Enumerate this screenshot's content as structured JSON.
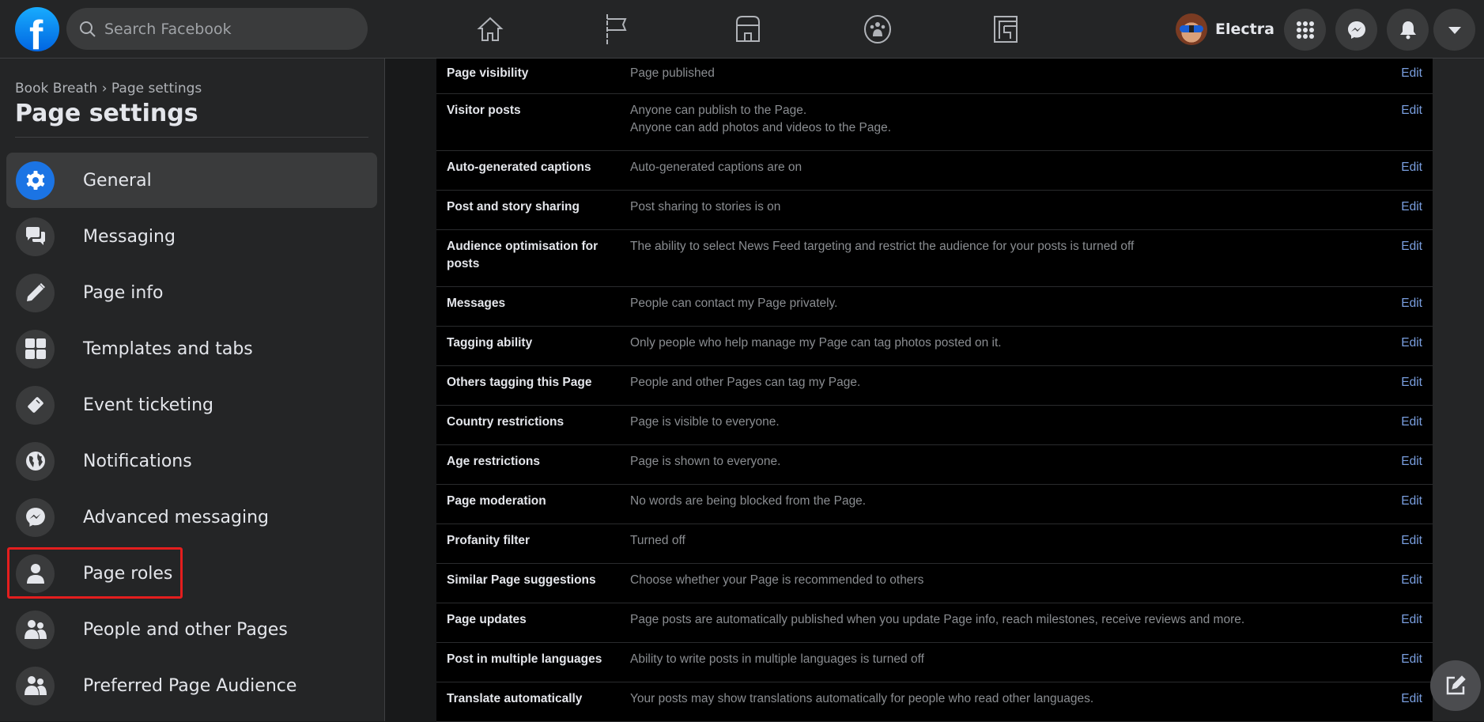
{
  "header": {
    "search_placeholder": "Search Facebook",
    "user_name": "Electra"
  },
  "sidebar": {
    "breadcrumb": "Book Breath › Page settings",
    "title": "Page settings",
    "items": [
      {
        "label": "General",
        "icon": "gear-icon",
        "active": true
      },
      {
        "label": "Messaging",
        "icon": "chat-bubbles-icon"
      },
      {
        "label": "Page info",
        "icon": "pencil-icon"
      },
      {
        "label": "Templates and tabs",
        "icon": "grid-icon"
      },
      {
        "label": "Event ticketing",
        "icon": "ticket-icon"
      },
      {
        "label": "Notifications",
        "icon": "globe-icon"
      },
      {
        "label": "Advanced messaging",
        "icon": "messenger-icon"
      },
      {
        "label": "Page roles",
        "icon": "person-icon",
        "highlighted": true
      },
      {
        "label": "People and other Pages",
        "icon": "people-icon"
      },
      {
        "label": "Preferred Page Audience",
        "icon": "people-icon"
      }
    ]
  },
  "settings": {
    "edit_label": "Edit",
    "rows": [
      {
        "label": "Page visibility",
        "value": "Page published"
      },
      {
        "label": "Visitor posts",
        "value": "Anyone can publish to the Page.",
        "value2": "Anyone can add photos and videos to the Page."
      },
      {
        "label": "Auto-generated captions",
        "value": "Auto-generated captions are on"
      },
      {
        "label": "Post and story sharing",
        "value": "Post sharing to stories is on"
      },
      {
        "label": "Audience optimisation for posts",
        "value": "The ability to select News Feed targeting and restrict the audience for your posts is turned off"
      },
      {
        "label": "Messages",
        "value": "People can contact my Page privately."
      },
      {
        "label": "Tagging ability",
        "value": "Only people who help manage my Page can tag photos posted on it."
      },
      {
        "label": "Others tagging this Page",
        "value": "People and other Pages can tag my Page."
      },
      {
        "label": "Country restrictions",
        "value": "Page is visible to everyone."
      },
      {
        "label": "Age restrictions",
        "value": "Page is shown to everyone."
      },
      {
        "label": "Page moderation",
        "value": "No words are being blocked from the Page."
      },
      {
        "label": "Profanity filter",
        "value": "Turned off"
      },
      {
        "label": "Similar Page suggestions",
        "value": "Choose whether your Page is recommended to others"
      },
      {
        "label": "Page updates",
        "value": "Page posts are automatically published when you update Page info, reach milestones, receive reviews and more."
      },
      {
        "label": "Post in multiple languages",
        "value": "Ability to write posts in multiple languages is turned off"
      },
      {
        "label": "Translate automatically",
        "value": "Your posts may show translations automatically for people who read other languages."
      }
    ]
  },
  "colors": {
    "accent": "#1b74e4",
    "edit_link": "#7a9fe0",
    "highlight": "#e41e1e"
  }
}
